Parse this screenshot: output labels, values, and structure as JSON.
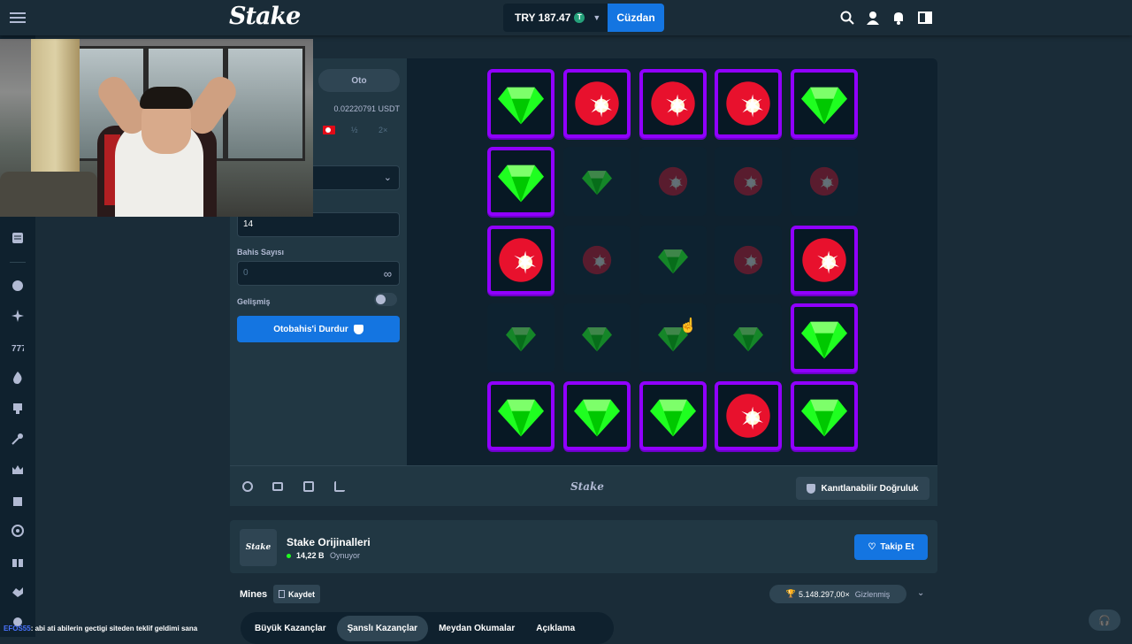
{
  "header": {
    "logo": "Stake",
    "balance": "TRY 187.47",
    "currency_badge": "T",
    "wallet_label": "Cüzdan",
    "icons": [
      "search-icon",
      "user-icon",
      "bell-icon",
      "sidebar-toggle-icon"
    ]
  },
  "bet_panel": {
    "mode_tab": "Oto",
    "usdt_value": "0.02220791 USDT",
    "half_label": "½",
    "double_label": "2×",
    "mines_field_value": "14",
    "bet_count_label": "Bahis Sayısı",
    "bet_count_value": "0",
    "advanced_label": "Gelişmiş",
    "stop_button_label": "Otobahis'i Durdur"
  },
  "board": {
    "rows": [
      [
        "gem",
        "mine",
        "mine",
        "mine",
        "gem"
      ],
      [
        "gem",
        "gem-dim",
        "mine-dim",
        "mine-dim",
        "mine-dim"
      ],
      [
        "mine",
        "mine-dim",
        "gem-dim",
        "mine-dim",
        "mine"
      ],
      [
        "gem-dim",
        "gem-dim",
        "gem-dim",
        "gem-dim",
        "gem"
      ],
      [
        "gem",
        "gem",
        "gem",
        "mine",
        "gem"
      ]
    ]
  },
  "footer_bar": {
    "brand": "Stake",
    "fairness_label": "Kanıtlanabilir Doğruluk",
    "icons": [
      "settings-icon",
      "theater-icon",
      "stats-icon",
      "popout-icon"
    ]
  },
  "publisher": {
    "name": "Stake Orijinalleri",
    "thumb": "Stake",
    "player_count": "14,22 B",
    "playing_label": "Oynuyor",
    "follow_label": "Takip Et"
  },
  "game": {
    "title": "Mines",
    "save_label": "Kaydet",
    "record": "5.148.297,00×",
    "hidden_label": "Gizlenmiş"
  },
  "leaderboard_tabs": [
    "Büyük Kazançlar",
    "Şanslı Kazançlar",
    "Meydan Okumalar",
    "Açıklama"
  ],
  "chat": {
    "user": "EFOS55",
    "message": ": abi ati abilerin gectigi siteden teklif geldimi sana"
  },
  "colors": {
    "accent": "#1475e1",
    "background": "#1a2c38",
    "panel": "#213743",
    "tile_border": "#9000ff",
    "gem": "#1fff20",
    "mine": "#e8112d"
  }
}
